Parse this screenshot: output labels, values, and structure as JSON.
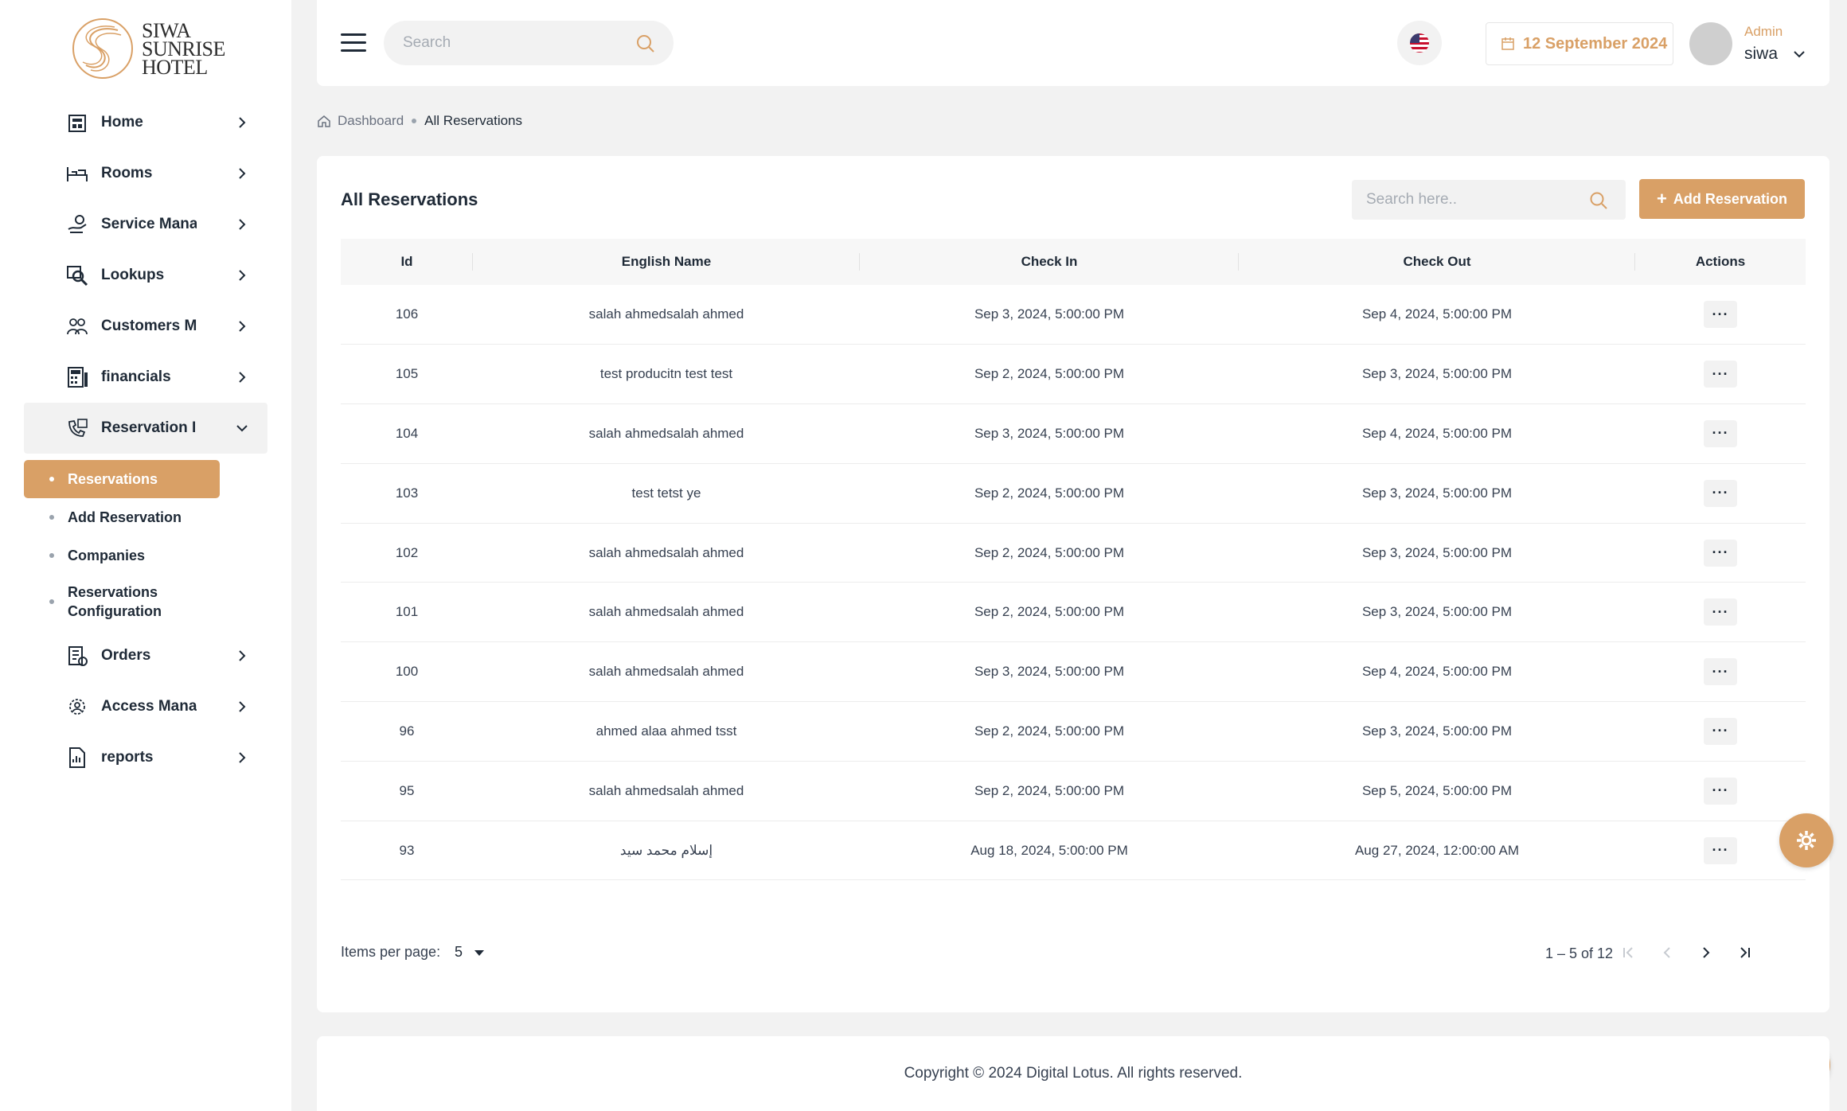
{
  "brand": {
    "logo_lines": [
      "SIWA",
      "SUNRISE",
      "HOTEL"
    ],
    "accent": "#d9a066"
  },
  "sidebar": {
    "items": [
      {
        "label": "Home",
        "icon": "home-icon"
      },
      {
        "label": "Rooms",
        "icon": "bed-icon"
      },
      {
        "label": "Service Mana",
        "icon": "service-icon"
      },
      {
        "label": "Lookups",
        "icon": "lookup-icon"
      },
      {
        "label": "Customers M",
        "icon": "customers-icon"
      },
      {
        "label": "financials",
        "icon": "calculator-icon"
      },
      {
        "label": "Reservation I",
        "icon": "reservation-icon"
      },
      {
        "label": "Orders",
        "icon": "orders-icon"
      },
      {
        "label": "Access Manag",
        "icon": "access-icon"
      },
      {
        "label": "reports",
        "icon": "reports-icon"
      }
    ],
    "sub_items": [
      {
        "label": "Reservations"
      },
      {
        "label": "Add Reservation"
      },
      {
        "label": "Companies"
      },
      {
        "label": "Reservations Configuration"
      }
    ]
  },
  "topbar": {
    "search_placeholder": "Search",
    "date": "12 September 2024",
    "user_role": "Admin",
    "user_name": "siwa"
  },
  "breadcrumb": {
    "home": "Dashboard",
    "current": "All Reservations"
  },
  "reservations": {
    "title": "All Reservations",
    "search_placeholder": "Search here..",
    "add_button": "Add Reservation",
    "columns": [
      "Id",
      "English Name",
      "Check In",
      "Check Out",
      "Actions"
    ],
    "rows": [
      {
        "id": "106",
        "name": "salah ahmedsalah ahmed",
        "check_in": "Sep 3, 2024, 5:00:00 PM",
        "check_out": "Sep 4, 2024, 5:00:00 PM"
      },
      {
        "id": "105",
        "name": "test producitn test test",
        "check_in": "Sep 2, 2024, 5:00:00 PM",
        "check_out": "Sep 3, 2024, 5:00:00 PM"
      },
      {
        "id": "104",
        "name": "salah ahmedsalah ahmed",
        "check_in": "Sep 3, 2024, 5:00:00 PM",
        "check_out": "Sep 4, 2024, 5:00:00 PM"
      },
      {
        "id": "103",
        "name": "test tetst ye",
        "check_in": "Sep 2, 2024, 5:00:00 PM",
        "check_out": "Sep 3, 2024, 5:00:00 PM"
      },
      {
        "id": "102",
        "name": "salah ahmedsalah ahmed",
        "check_in": "Sep 2, 2024, 5:00:00 PM",
        "check_out": "Sep 3, 2024, 5:00:00 PM"
      },
      {
        "id": "101",
        "name": "salah ahmedsalah ahmed",
        "check_in": "Sep 2, 2024, 5:00:00 PM",
        "check_out": "Sep 3, 2024, 5:00:00 PM"
      },
      {
        "id": "100",
        "name": "salah ahmedsalah ahmed",
        "check_in": "Sep 3, 2024, 5:00:00 PM",
        "check_out": "Sep 4, 2024, 5:00:00 PM"
      },
      {
        "id": "96",
        "name": "ahmed alaa ahmed tsst",
        "check_in": "Sep 2, 2024, 5:00:00 PM",
        "check_out": "Sep 3, 2024, 5:00:00 PM"
      },
      {
        "id": "95",
        "name": "salah ahmedsalah ahmed",
        "check_in": "Sep 2, 2024, 5:00:00 PM",
        "check_out": "Sep 5, 2024, 5:00:00 PM"
      },
      {
        "id": "93",
        "name": "إسلام محمد سيد",
        "check_in": "Aug 18, 2024, 5:00:00 PM",
        "check_out": "Aug 27, 2024, 12:00:00 AM"
      }
    ],
    "actions_label": "···",
    "items_per_page_label": "Items per page:",
    "items_per_page": "5",
    "range": "1 – 5 of 12"
  },
  "footer": {
    "copyright": "Copyright © 2024 Digital Lotus. All rights reserved."
  }
}
